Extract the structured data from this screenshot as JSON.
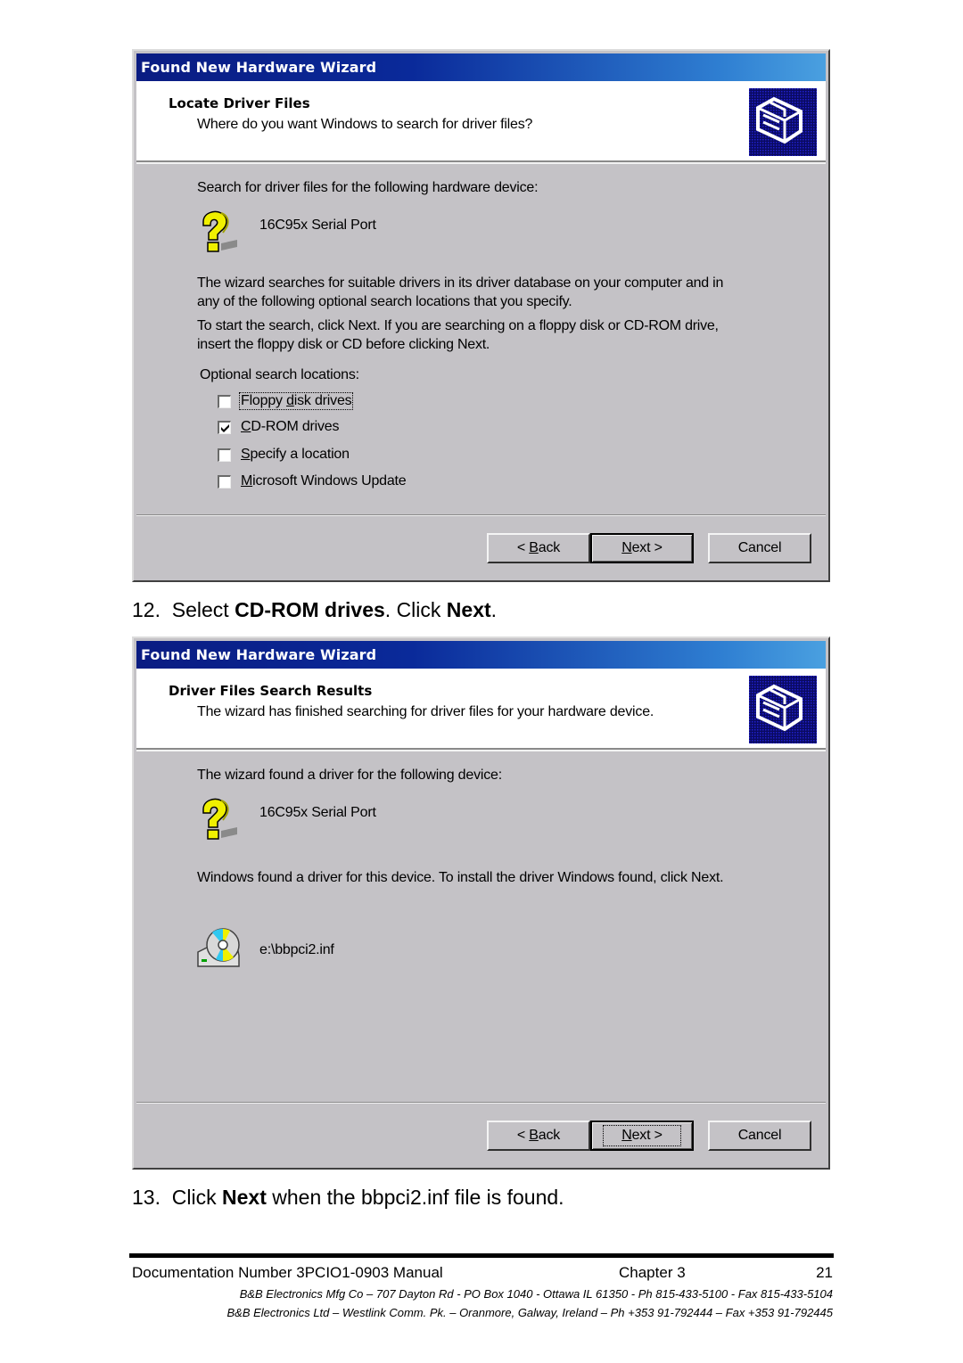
{
  "dialog1": {
    "title": "Found New Hardware Wizard",
    "header_title": "Locate Driver Files",
    "header_subtitle": "Where do you want Windows to search for driver files?",
    "intro": "Search for driver files for the following hardware device:",
    "device_name": "16C95x Serial Port",
    "para1_line1": "The wizard searches for suitable drivers in its driver database on your computer and in",
    "para1_line2": "any of the following optional search locations that you specify.",
    "para2_line1": "To start the search, click Next. If you are searching on a floppy disk or CD-ROM drive,",
    "para2_line2": "insert the floppy disk or CD before clicking Next.",
    "optional_label": "Optional search locations:",
    "options": [
      {
        "label": "Floppy disk drives",
        "checked": false,
        "accel": "d",
        "focused": true
      },
      {
        "label": "CD-ROM drives",
        "checked": true,
        "accel": "C",
        "focused": false
      },
      {
        "label": "Specify a location",
        "checked": false,
        "accel": "S",
        "focused": false
      },
      {
        "label": "Microsoft Windows Update",
        "checked": false,
        "accel": "M",
        "focused": false
      }
    ],
    "buttons": {
      "back": "< Back",
      "next": "Next >",
      "cancel": "Cancel"
    }
  },
  "step12": {
    "number": "12.",
    "text_a": "Select ",
    "bold_a": "CD-ROM drives",
    "text_b": ". Click ",
    "bold_b": "Next",
    "text_c": "."
  },
  "dialog2": {
    "title": "Found New Hardware Wizard",
    "header_title": "Driver Files Search Results",
    "header_subtitle": "The wizard has finished searching for driver files for your hardware device.",
    "intro": "The wizard found a driver for the following device:",
    "device_name": "16C95x Serial Port",
    "found_text": "Windows found a driver for this device. To install the driver Windows found, click Next.",
    "driver_file": "e:\\bbpci2.inf",
    "buttons": {
      "back": "< Back",
      "next": "Next >",
      "cancel": "Cancel"
    }
  },
  "step13": {
    "number": "13.",
    "text_a": "Click ",
    "bold_a": "Next",
    "text_b": " when the bbpci2.inf file is found."
  },
  "footer": {
    "doc_number": "Documentation Number 3PCIO1-0903 Manual",
    "chapter": "Chapter 3",
    "page": "21",
    "address_us": "B&B Electronics Mfg Co – 707 Dayton Rd - PO Box 1040 - Ottawa IL 61350 - Ph 815-433-5100 - Fax 815-433-5104",
    "address_ie": "B&B Electronics Ltd – Westlink Comm. Pk. – Oranmore, Galway, Ireland – Ph +353 91-792444 – Fax +353 91-792445"
  },
  "colors": {
    "titlebar_start": "#0a1c82",
    "titlebar_end": "#4aa0e0",
    "dialog_bg": "#c4c2c6",
    "icon_yellow": "#f0f000"
  }
}
